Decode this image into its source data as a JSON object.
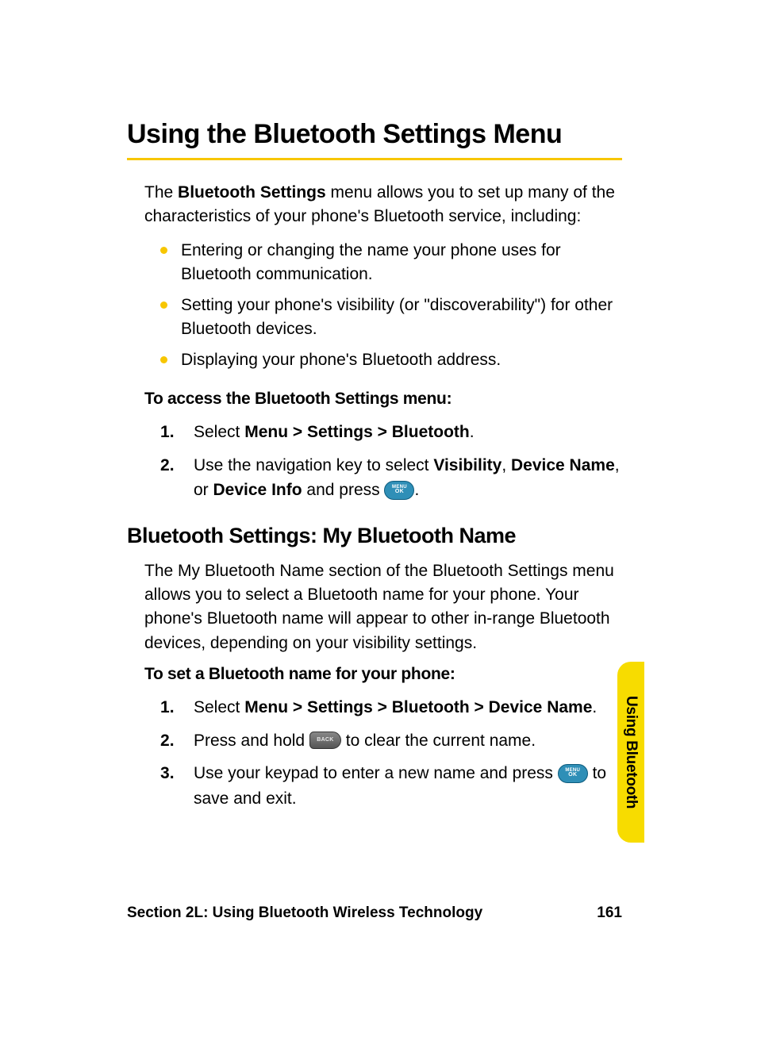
{
  "heading1": "Using the Bluetooth Settings Menu",
  "intro": {
    "pre": "The ",
    "bold": "Bluetooth Settings",
    "post": " menu allows you to set up many of the characteristics of your phone's Bluetooth service, including:"
  },
  "bullets": [
    "Entering or changing the name your phone uses for Bluetooth communication.",
    "Setting your phone's visibility (or \"discoverability\") for other Bluetooth devices.",
    "Displaying your phone's Bluetooth address."
  ],
  "access_heading": "To access the Bluetooth Settings menu:",
  "access_steps": {
    "s1_pre": "Select ",
    "s1_bold": "Menu > Settings > Bluetooth",
    "s1_post": ".",
    "s2_pre": "Use the navigation key to select ",
    "s2_b1": "Visibility",
    "s2_sep1": ", ",
    "s2_b2": "Device Name",
    "s2_sep2": ", or ",
    "s2_b3": "Device Info",
    "s2_mid": " and press ",
    "s2_post": "."
  },
  "heading2": "Bluetooth Settings: My Bluetooth Name",
  "name_para": "The My Bluetooth Name section of the Bluetooth Settings menu allows you to select a Bluetooth name for your phone. Your phone's Bluetooth name will appear to other in-range Bluetooth devices, depending on your visibility settings.",
  "set_heading": "To set a Bluetooth name for your phone:",
  "set_steps": {
    "s1_pre": "Select ",
    "s1_bold": "Menu > Settings > Bluetooth > Device Name",
    "s1_post": ".",
    "s2_pre": "Press and hold ",
    "s2_post": " to clear the current name.",
    "s3_pre": "Use your keypad to enter a new name and press ",
    "s3_post": " to save and exit."
  },
  "icons": {
    "menu_ok_l1": "MENU",
    "menu_ok_l2": "OK",
    "back": "BACK"
  },
  "side_tab": "Using Bluetooth",
  "footer_left": "Section 2L: Using Bluetooth Wireless Technology",
  "footer_right": "161"
}
